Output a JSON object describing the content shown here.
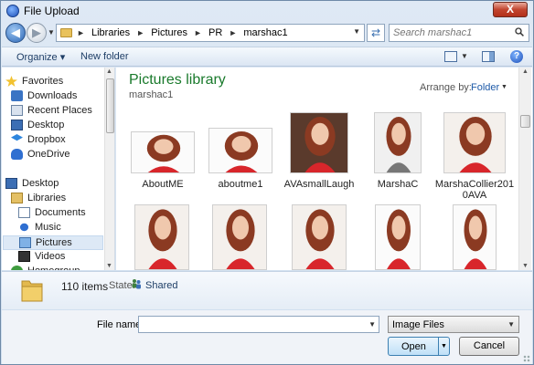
{
  "window": {
    "title": "File Upload",
    "close_label": "X"
  },
  "address": {
    "breadcrumbs": [
      "Libraries",
      "Pictures",
      "PR",
      "marshac1"
    ],
    "search_placeholder": "Search marshac1"
  },
  "toolbar": {
    "organize": "Organize ▾",
    "new_folder": "New folder"
  },
  "nav": {
    "items": [
      {
        "label": "Favorites",
        "icon": "star-icon"
      },
      {
        "label": "Downloads",
        "icon": "downloads-icon"
      },
      {
        "label": "Recent Places",
        "icon": "recent-places-icon"
      },
      {
        "label": "Desktop",
        "icon": "desktop-icon"
      },
      {
        "label": "Dropbox",
        "icon": "dropbox-icon"
      },
      {
        "label": "OneDrive",
        "icon": "onedrive-icon"
      },
      {
        "label": "Desktop",
        "icon": "desktop-icon"
      },
      {
        "label": "Libraries",
        "icon": "libraries-icon"
      },
      {
        "label": "Documents",
        "icon": "documents-icon"
      },
      {
        "label": "Music",
        "icon": "music-icon"
      },
      {
        "label": "Pictures",
        "icon": "pictures-icon"
      },
      {
        "label": "Videos",
        "icon": "videos-icon"
      },
      {
        "label": "Homegroup",
        "icon": "homegroup-icon"
      }
    ]
  },
  "library": {
    "title": "Pictures library",
    "subtitle": "marshac1",
    "arrange_label": "Arrange by:",
    "arrange_value": "Folder"
  },
  "files": [
    {
      "name": "AboutME"
    },
    {
      "name": "aboutme1"
    },
    {
      "name": "AVAsmallLaugh"
    },
    {
      "name": "MarshaC"
    },
    {
      "name": "MarshaCollier2010AVA",
      "line1": "MarshaCollier201",
      "line2": "0AVA"
    },
    {
      "name": ""
    },
    {
      "name": ""
    },
    {
      "name": ""
    },
    {
      "name": ""
    },
    {
      "name": ""
    }
  ],
  "details": {
    "count": "110 items",
    "state_label": "State:",
    "state_value": "Shared"
  },
  "bottom": {
    "file_name_label": "File name:",
    "file_name_value": "",
    "filter": "Image Files",
    "open": "Open",
    "cancel": "Cancel"
  },
  "colors": {
    "library_title": "#1a7a2c",
    "link_blue": "#1e5aa8",
    "hair": "#8b3a22",
    "dress": "#d8262b"
  }
}
